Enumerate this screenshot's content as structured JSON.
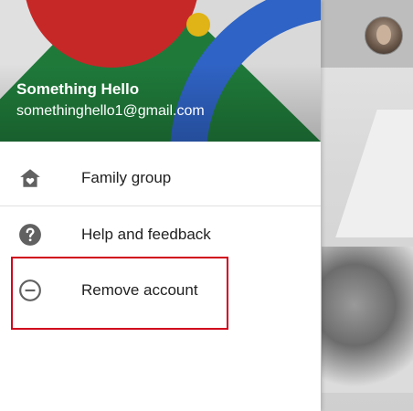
{
  "account": {
    "name": "Something Hello",
    "email": "somethinghello1@gmail.com"
  },
  "menu": {
    "items": [
      {
        "label": "Family group",
        "icon": "family-group-icon"
      },
      {
        "label": "Help and feedback",
        "icon": "help-icon"
      },
      {
        "label": "Remove account",
        "icon": "remove-circle-icon"
      }
    ]
  },
  "colors": {
    "header_green": "#1f7a3a",
    "header_red": "#c62828",
    "header_blue": "#2f63c5",
    "header_yellow": "#e0b316",
    "highlight_border": "#d0021b"
  }
}
